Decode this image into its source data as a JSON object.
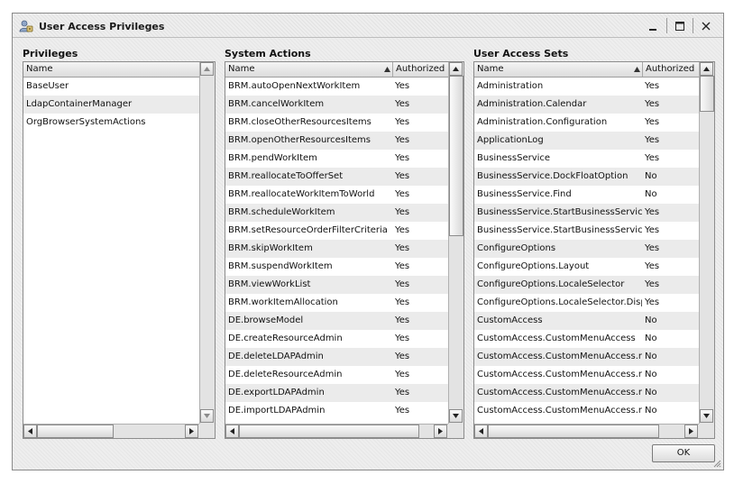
{
  "window": {
    "title": "User Access Privileges"
  },
  "privileges": {
    "title": "Privileges",
    "columns": [
      "Name"
    ],
    "rows": [
      "BaseUser",
      "LdapContainerManager",
      "OrgBrowserSystemActions"
    ]
  },
  "system_actions": {
    "title": "System Actions",
    "columns": [
      "Name",
      "Authorized"
    ],
    "rows": [
      [
        "BRM.autoOpenNextWorkItem",
        "Yes"
      ],
      [
        "BRM.cancelWorkItem",
        "Yes"
      ],
      [
        "BRM.closeOtherResourcesItems",
        "Yes"
      ],
      [
        "BRM.openOtherResourcesItems",
        "Yes"
      ],
      [
        "BRM.pendWorkItem",
        "Yes"
      ],
      [
        "BRM.reallocateToOfferSet",
        "Yes"
      ],
      [
        "BRM.reallocateWorkItemToWorld",
        "Yes"
      ],
      [
        "BRM.scheduleWorkItem",
        "Yes"
      ],
      [
        "BRM.setResourceOrderFilterCriteria",
        "Yes"
      ],
      [
        "BRM.skipWorkItem",
        "Yes"
      ],
      [
        "BRM.suspendWorkItem",
        "Yes"
      ],
      [
        "BRM.viewWorkList",
        "Yes"
      ],
      [
        "BRM.workItemAllocation",
        "Yes"
      ],
      [
        "DE.browseModel",
        "Yes"
      ],
      [
        "DE.createResourceAdmin",
        "Yes"
      ],
      [
        "DE.deleteLDAPAdmin",
        "Yes"
      ],
      [
        "DE.deleteResourceAdmin",
        "Yes"
      ],
      [
        "DE.exportLDAPAdmin",
        "Yes"
      ],
      [
        "DE.importLDAPAdmin",
        "Yes"
      ]
    ]
  },
  "user_access_sets": {
    "title": "User Access Sets",
    "columns": [
      "Name",
      "Authorized"
    ],
    "rows": [
      [
        "Administration",
        "Yes"
      ],
      [
        "Administration.Calendar",
        "Yes"
      ],
      [
        "Administration.Configuration",
        "Yes"
      ],
      [
        "ApplicationLog",
        "Yes"
      ],
      [
        "BusinessService",
        "Yes"
      ],
      [
        "BusinessService.DockFloatOption",
        "No"
      ],
      [
        "BusinessService.Find",
        "No"
      ],
      [
        "BusinessService.StartBusinessService",
        "Yes"
      ],
      [
        "BusinessService.StartBusinessService.F",
        "Yes"
      ],
      [
        "ConfigureOptions",
        "Yes"
      ],
      [
        "ConfigureOptions.Layout",
        "Yes"
      ],
      [
        "ConfigureOptions.LocaleSelector",
        "Yes"
      ],
      [
        "ConfigureOptions.LocaleSelector.Displ",
        "Yes"
      ],
      [
        "CustomAccess",
        "No"
      ],
      [
        "CustomAccess.CustomMenuAccess",
        "No"
      ],
      [
        "CustomAccess.CustomMenuAccess.mei",
        "No"
      ],
      [
        "CustomAccess.CustomMenuAccess.mei",
        "No"
      ],
      [
        "CustomAccess.CustomMenuAccess.mei",
        "No"
      ],
      [
        "CustomAccess.CustomMenuAccess.mei",
        "No"
      ]
    ]
  },
  "footer": {
    "ok_label": "OK"
  },
  "icons": {
    "app": "user-access-icon",
    "minimize": "minimize-icon",
    "maximize": "maximize-icon",
    "close": "close-icon",
    "sort": "sort-ascending-icon",
    "scroll_up": "arrow-up-icon",
    "scroll_down": "arrow-down-icon",
    "scroll_left": "arrow-left-icon",
    "scroll_right": "arrow-right-icon"
  }
}
